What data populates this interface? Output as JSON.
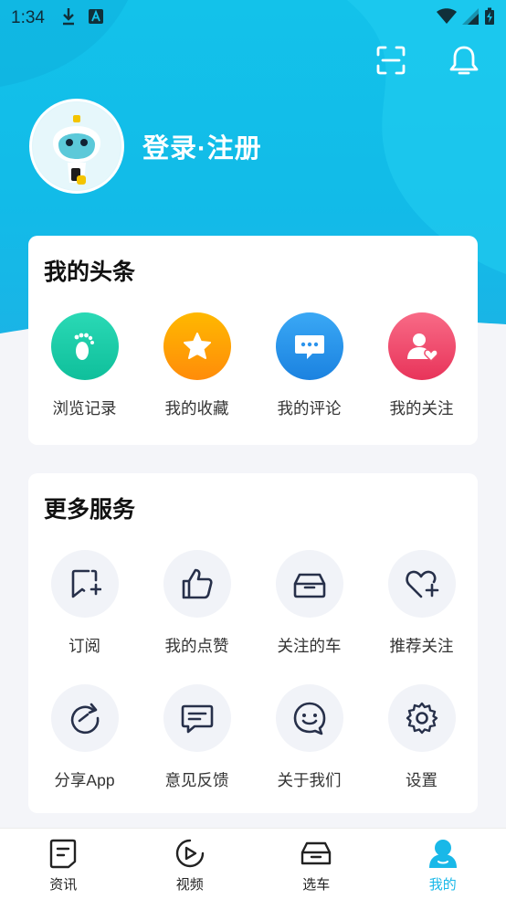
{
  "status_bar": {
    "time": "1:34",
    "icons": [
      "download-icon",
      "a-icon",
      "wifi-icon",
      "signal-icon",
      "battery-charging-icon"
    ]
  },
  "header": {
    "icons": [
      "scan-icon",
      "bell-icon"
    ],
    "login_label": "登录·注册"
  },
  "my_toutiao": {
    "title": "我的头条",
    "items": [
      {
        "label": "浏览记录",
        "icon": "footprint-icon",
        "color": "#16c7a4"
      },
      {
        "label": "我的收藏",
        "icon": "star-icon",
        "color": "#ff9d05"
      },
      {
        "label": "我的评论",
        "icon": "comment-icon",
        "color": "#2b93ec"
      },
      {
        "label": "我的关注",
        "icon": "follow-user-icon",
        "color": "#f04e6e"
      }
    ]
  },
  "more_services": {
    "title": "更多服务",
    "items": [
      {
        "label": "订阅",
        "icon": "subscribe-bookmark-icon"
      },
      {
        "label": "我的点赞",
        "icon": "thumbs-up-icon"
      },
      {
        "label": "关注的车",
        "icon": "car-icon"
      },
      {
        "label": "推荐关注",
        "icon": "heart-plus-icon"
      },
      {
        "label": "分享App",
        "icon": "share-icon"
      },
      {
        "label": "意见反馈",
        "icon": "feedback-icon"
      },
      {
        "label": "关于我们",
        "icon": "smiley-chat-icon"
      },
      {
        "label": "设置",
        "icon": "gear-icon"
      }
    ]
  },
  "tabbar": {
    "tabs": [
      {
        "label": "资讯",
        "icon": "news-icon"
      },
      {
        "label": "视频",
        "icon": "video-play-icon"
      },
      {
        "label": "选车",
        "icon": "car-select-icon"
      },
      {
        "label": "我的",
        "icon": "me-icon",
        "active": true
      }
    ],
    "active_color": "#19b8e8"
  },
  "colors": {
    "hero": "#13c2ea",
    "background": "#f4f5f9",
    "icon_stroke": "#27304a"
  }
}
